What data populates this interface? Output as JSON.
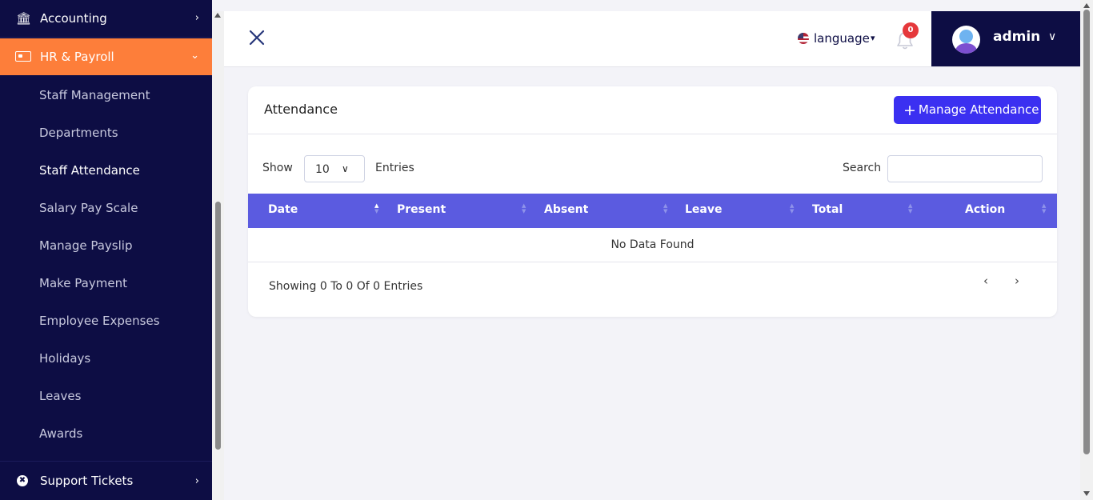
{
  "sidebar": {
    "top_item": {
      "label": "Accounting"
    },
    "active_item": {
      "label": "HR & Payroll"
    },
    "sub_items": [
      {
        "label": "Staff Management"
      },
      {
        "label": "Departments"
      },
      {
        "label": "Staff Attendance"
      },
      {
        "label": "Salary Pay Scale"
      },
      {
        "label": "Manage Payslip"
      },
      {
        "label": "Make Payment"
      },
      {
        "label": "Employee Expenses"
      },
      {
        "label": "Holidays"
      },
      {
        "label": "Leaves"
      },
      {
        "label": "Awards"
      }
    ],
    "bottom_item": {
      "label": "Support Tickets"
    }
  },
  "header": {
    "language_label": "language",
    "notification_count": "0",
    "user_name": "admin"
  },
  "card": {
    "title": "Attendance",
    "manage_button": "Manage Attendance",
    "show_label": "Show",
    "entries_value": "10",
    "entries_label": "Entries",
    "search_label": "Search",
    "columns": [
      "Date",
      "Present",
      "Absent",
      "Leave",
      "Total",
      "Action"
    ],
    "empty_message": "No Data Found",
    "showing_text": "Showing 0 To 0 Of 0 Entries"
  },
  "colors": {
    "sidebar_bg": "#0d0d44",
    "active_item": "#fd7e3a",
    "table_header": "#5b5be0",
    "primary_button": "#3b30f1",
    "badge": "#e5383b"
  },
  "icons": {
    "accounting": "bank-icon",
    "hr": "id-card-icon",
    "support": "lifebuoy-icon",
    "close": "close-icon",
    "bell": "bell-icon",
    "flag": "us-flag-icon"
  }
}
